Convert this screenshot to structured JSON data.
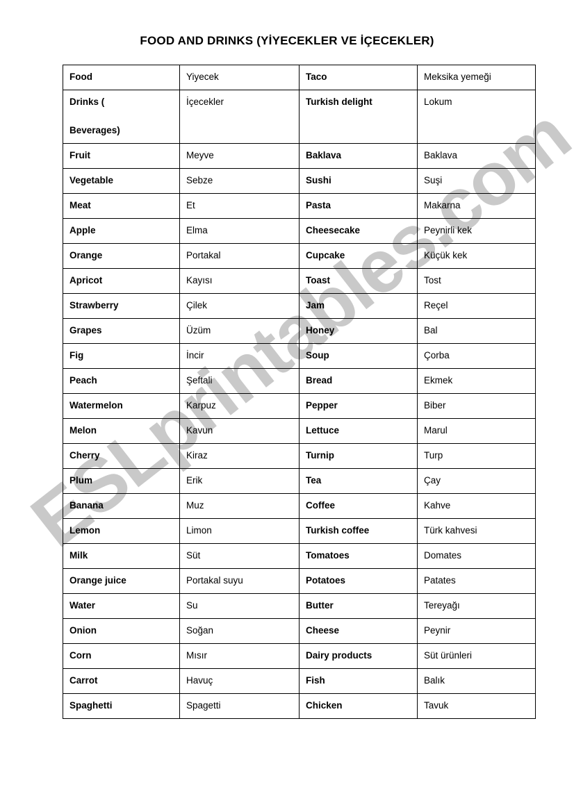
{
  "document": {
    "title": "FOOD AND DRINKS  (YİYECEKLER VE İÇECEKLER)",
    "watermark": "ESLprintables.com",
    "watermark_color": "#c9c9c9"
  },
  "table": {
    "rows": [
      {
        "english_left": "Food",
        "turkish_left": "Yiyecek",
        "english_right": "Taco",
        "turkish_right": "Meksika yemeği"
      },
      {
        "english_left": "Drinks (",
        "english_left_line2": "Beverages)",
        "turkish_left": "İçecekler",
        "english_right": "Turkish delight",
        "turkish_right": "Lokum",
        "tall": true
      },
      {
        "english_left": "Fruit",
        "turkish_left": "Meyve",
        "english_right": "Baklava",
        "turkish_right": "Baklava"
      },
      {
        "english_left": "Vegetable",
        "turkish_left": "Sebze",
        "english_right": "Sushi",
        "turkish_right": "Suşi"
      },
      {
        "english_left": "Meat",
        "turkish_left": "Et",
        "english_right": "Pasta",
        "turkish_right": "Makarna"
      },
      {
        "english_left": "Apple",
        "turkish_left": "Elma",
        "english_right": "Cheesecake",
        "turkish_right": "Peynirli kek"
      },
      {
        "english_left": "Orange",
        "turkish_left": "Portakal",
        "english_right": "Cupcake",
        "turkish_right": "Küçük kek"
      },
      {
        "english_left": "Apricot",
        "turkish_left": "Kayısı",
        "english_right": "Toast",
        "turkish_right": "Tost"
      },
      {
        "english_left": "Strawberry",
        "turkish_left": "Çilek",
        "english_right": "Jam",
        "turkish_right": "Reçel"
      },
      {
        "english_left": "Grapes",
        "turkish_left": "Üzüm",
        "english_right": "Honey",
        "turkish_right": "Bal"
      },
      {
        "english_left": "Fig",
        "turkish_left": "İncir",
        "english_right": "Soup",
        "turkish_right": "Çorba"
      },
      {
        "english_left": "Peach",
        "turkish_left": "Şeftali",
        "english_right": "Bread",
        "turkish_right": "Ekmek"
      },
      {
        "english_left": "Watermelon",
        "turkish_left": "Karpuz",
        "english_right": "Pepper",
        "turkish_right": "Biber"
      },
      {
        "english_left": "Melon",
        "turkish_left": "Kavun",
        "english_right": "Lettuce",
        "turkish_right": "Marul"
      },
      {
        "english_left": "Cherry",
        "turkish_left": "Kiraz",
        "english_right": "Turnip",
        "turkish_right": "Turp"
      },
      {
        "english_left": "Plum",
        "turkish_left": "Erik",
        "english_right": "Tea",
        "turkish_right": "Çay"
      },
      {
        "english_left": "Banana",
        "turkish_left": "Muz",
        "english_right": "Coffee",
        "turkish_right": "Kahve"
      },
      {
        "english_left": "Lemon",
        "turkish_left": "Limon",
        "english_right": "Turkish coffee",
        "turkish_right": "Türk kahvesi"
      },
      {
        "english_left": "Milk",
        "turkish_left": "Süt",
        "english_right": "Tomatoes",
        "turkish_right": "Domates"
      },
      {
        "english_left": "Orange juice",
        "turkish_left": "Portakal suyu",
        "english_right": "Potatoes",
        "turkish_right": "Patates"
      },
      {
        "english_left": "Water",
        "turkish_left": "Su",
        "english_right": "Butter",
        "turkish_right": "Tereyağı"
      },
      {
        "english_left": "Onion",
        "turkish_left": "Soğan",
        "english_right": "Cheese",
        "turkish_right": "Peynir"
      },
      {
        "english_left": "Corn",
        "turkish_left": "Mısır",
        "english_right": "Dairy products",
        "turkish_right": "Süt ürünleri"
      },
      {
        "english_left": "Carrot",
        "turkish_left": "Havuç",
        "english_right": "Fish",
        "turkish_right": "Balık"
      },
      {
        "english_left": "Spaghetti",
        "turkish_left": "Spagetti",
        "english_right": "Chicken",
        "turkish_right": "Tavuk"
      }
    ]
  }
}
